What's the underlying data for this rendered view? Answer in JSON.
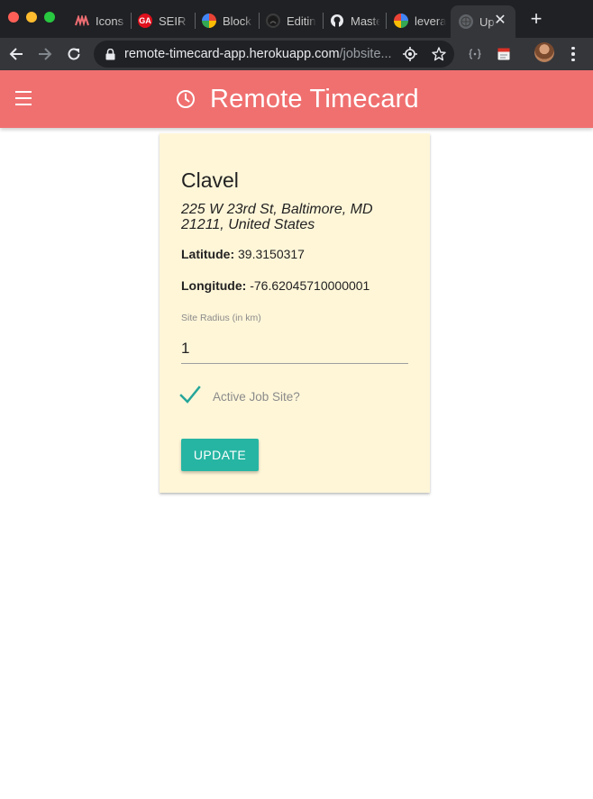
{
  "browser": {
    "tabs": [
      {
        "label": "Icons",
        "icon": "materialize-icon",
        "color": "#ee6e73"
      },
      {
        "label": "SEIR Dashboard",
        "icon": "ga-icon",
        "color": "#e0101d"
      },
      {
        "label": "Block",
        "icon": "google-icon",
        "color": "#4285f4"
      },
      {
        "label": "Editing",
        "icon": "github-icon",
        "color": "#ffffff"
      },
      {
        "label": "Master",
        "icon": "github-icon",
        "color": "#ffffff"
      },
      {
        "label": "leverage",
        "icon": "google-icon",
        "color": "#4285f4"
      },
      {
        "label": "Update",
        "icon": "globe-icon",
        "color": "#9aa0a6"
      }
    ],
    "ga_badge": "GA",
    "url_host": "remote-timecard-app.herokuapp.com",
    "url_path": "/jobsite..."
  },
  "app": {
    "title": "Remote Timecard",
    "accent": "#f07070"
  },
  "card": {
    "name": "Clavel",
    "address": "225 W 23rd St, Baltimore, MD 21211, United States",
    "latitude_label": "Latitude:",
    "latitude": "39.3150317",
    "longitude_label": "Longitude:",
    "longitude": "-76.62045710000001",
    "radius_label": "Site Radius (in km)",
    "radius_value": "1",
    "active_label": "Active Job Site?",
    "active_checked": true,
    "update_label": "UPDATE",
    "button_color": "#26b5a3"
  }
}
